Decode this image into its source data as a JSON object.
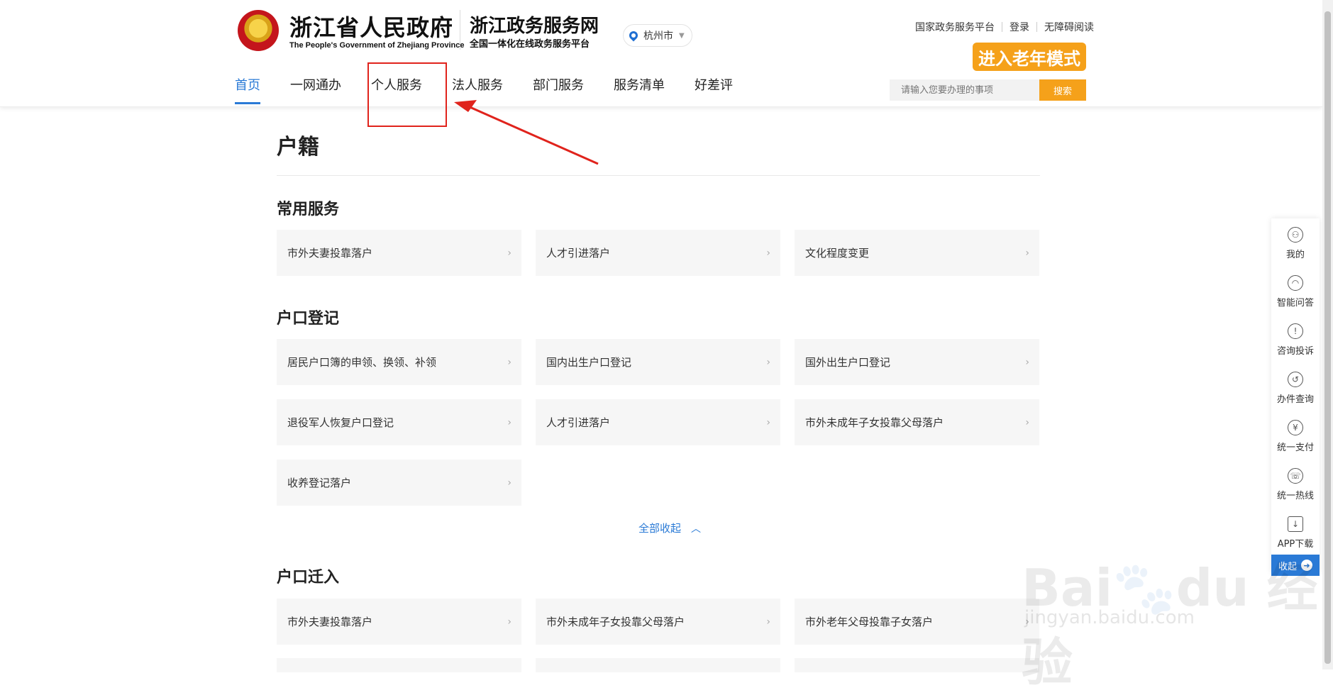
{
  "header": {
    "gov_title": "浙江省人民政府",
    "gov_subtitle": "The People's Government of Zhejiang Province",
    "service_title": "浙江政务服务网",
    "service_subtitle": "全国一体化在线政务服务平台",
    "city": "杭州市",
    "top_links": [
      "国家政务服务平台",
      "登录",
      "无障碍阅读"
    ],
    "elder_mode": "进入老年模式",
    "nav": [
      {
        "label": "首页",
        "active": true
      },
      {
        "label": "一网通办",
        "active": false
      },
      {
        "label": "个人服务",
        "active": false
      },
      {
        "label": "法人服务",
        "active": false
      },
      {
        "label": "部门服务",
        "active": false
      },
      {
        "label": "服务清单",
        "active": false
      },
      {
        "label": "好差评",
        "active": false
      }
    ],
    "search_placeholder": "请输入您要办理的事项",
    "search_button": "搜索"
  },
  "page": {
    "title": "户籍",
    "sections": [
      {
        "title": "常用服务",
        "items": [
          "市外夫妻投靠落户",
          "人才引进落户",
          "文化程度变更"
        ]
      },
      {
        "title": "户口登记",
        "items": [
          "居民户口簿的申领、换领、补领",
          "国内出生户口登记",
          "国外出生户口登记",
          "退役军人恢复户口登记",
          "人才引进落户",
          "市外未成年子女投靠父母落户",
          "收养登记落户"
        ]
      },
      {
        "title": "户口迁入",
        "items": [
          "市外夫妻投靠落户",
          "市外未成年子女投靠父母落户",
          "市外老年父母投靠子女落户"
        ]
      }
    ],
    "collapse_all": "全部收起"
  },
  "float_bar": {
    "items": [
      "我的",
      "智能问答",
      "咨询投诉",
      "办件查询",
      "统一支付",
      "统一热线",
      "APP下载"
    ],
    "collapse": "收起"
  },
  "colors": {
    "accent": "#2a7ad6",
    "orange": "#f5a11a",
    "annotation": "#e0231c"
  }
}
